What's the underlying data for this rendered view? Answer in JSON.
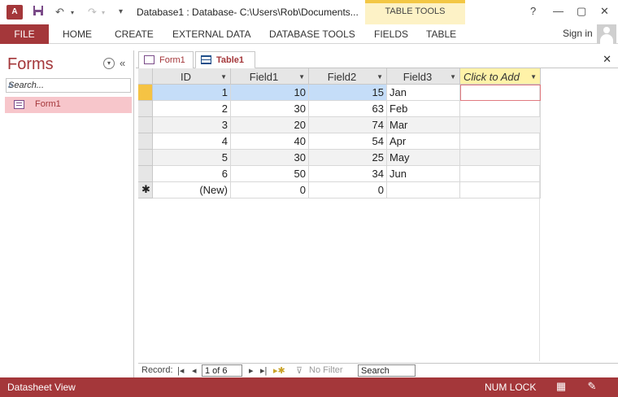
{
  "titlebar": {
    "app_icon_label": "A",
    "title": "Database1 : Database- C:\\Users\\Rob\\Documents...",
    "context_group": "TABLE TOOLS",
    "help_label": "?",
    "minimize_label": "—",
    "restore_label": "▢",
    "close_label": "✕"
  },
  "ribbon": {
    "tabs": [
      {
        "label": "FILE"
      },
      {
        "label": "HOME"
      },
      {
        "label": "CREATE"
      },
      {
        "label": "EXTERNAL DATA"
      },
      {
        "label": "DATABASE TOOLS"
      },
      {
        "label": "FIELDS"
      },
      {
        "label": "TABLE"
      }
    ],
    "sign_in": "Sign in"
  },
  "nav_pane": {
    "title": "Forms",
    "search_placeholder": "Search...",
    "items": [
      {
        "label": "Form1"
      }
    ]
  },
  "doc_tabs": [
    {
      "label": "Form1",
      "active": false
    },
    {
      "label": "Table1",
      "active": true
    }
  ],
  "table": {
    "columns": [
      "ID",
      "Field1",
      "Field2",
      "Field3",
      "Click to Add"
    ],
    "rows": [
      {
        "id": "1",
        "field1": "10",
        "field2": "15",
        "field3": "Jan"
      },
      {
        "id": "2",
        "field1": "30",
        "field2": "63",
        "field3": "Feb"
      },
      {
        "id": "3",
        "field1": "20",
        "field2": "74",
        "field3": "Mar"
      },
      {
        "id": "4",
        "field1": "40",
        "field2": "54",
        "field3": "Apr"
      },
      {
        "id": "5",
        "field1": "30",
        "field2": "25",
        "field3": "May"
      },
      {
        "id": "6",
        "field1": "50",
        "field2": "34",
        "field3": "Jun"
      }
    ],
    "new_row": {
      "marker": "✱",
      "id": "(New)",
      "field1": "0",
      "field2": "0"
    }
  },
  "record_nav": {
    "label": "Record:",
    "current": "1 of 6",
    "filter": "No Filter",
    "search": "Search"
  },
  "status_bar": {
    "view": "Datasheet View",
    "numlock": "NUM LOCK"
  },
  "colors": {
    "accent": "#a4373a",
    "context_tab": "#fdf2c6",
    "selected_row": "#c5ddf8"
  }
}
